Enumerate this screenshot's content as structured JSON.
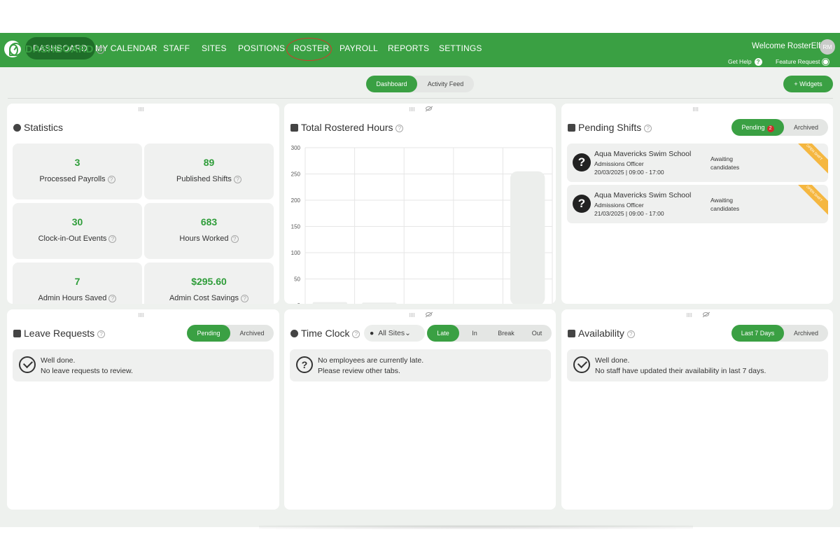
{
  "nav": {
    "items": [
      "DASHBOARD",
      "MY CALENDAR",
      "STAFF",
      "SITES",
      "POSITIONS",
      "ROSTER",
      "PAYROLL",
      "REPORTS",
      "SETTINGS"
    ],
    "welcome": "Welcome RosterElf",
    "avatar_initials": "RM",
    "get_help": "Get Help",
    "help_glyph": "?",
    "feature_request": "Feature Request"
  },
  "page": {
    "title": "DASHBOARD",
    "view_tabs": [
      "Dashboard",
      "Activity Feed"
    ],
    "widgets_button": "+ Widgets",
    "help_glyph": "?"
  },
  "statistics": {
    "title": "Statistics",
    "items": [
      {
        "value": "3",
        "label": "Processed Payrolls"
      },
      {
        "value": "89",
        "label": "Published Shifts"
      },
      {
        "value": "30",
        "label": "Clock-in-Out Events"
      },
      {
        "value": "683",
        "label": "Hours Worked"
      },
      {
        "value": "7",
        "label": "Admin Hours Saved"
      },
      {
        "value": "$295.60",
        "label": "Admin Cost Savings"
      }
    ]
  },
  "rostered_hours": {
    "title": "Total Rostered Hours"
  },
  "chart_data": {
    "type": "bar",
    "title": "Total Rostered Hours",
    "ylim": [
      0,
      300
    ],
    "yticks": [
      0,
      50,
      100,
      150,
      200,
      250,
      300
    ],
    "values": [
      6,
      5,
      2,
      0,
      255
    ],
    "bar_color": "#eceeec"
  },
  "pending_shifts": {
    "title": "Pending Shifts",
    "tabs": [
      "Pending",
      "Archived"
    ],
    "badge": "2",
    "shifts": [
      {
        "school": "Aqua Mavericks Swim School",
        "position": "Admissions Officer",
        "datetime": "20/03/2025 | 09:00 - 17:00",
        "status_line1": "Awaiting",
        "status_line2": "candidates",
        "ribbon": "OPEN SHIFT"
      },
      {
        "school": "Aqua Mavericks Swim School",
        "position": "Admissions Officer",
        "datetime": "21/03/2025 | 09:00 - 17:00",
        "status_line1": "Awaiting",
        "status_line2": "candidates",
        "ribbon": "OPEN SHIFT"
      }
    ]
  },
  "leave_requests": {
    "title": "Leave Requests",
    "tabs": [
      "Pending",
      "Archived"
    ],
    "msg_line1": "Well done.",
    "msg_line2": "No leave requests to review."
  },
  "time_clock": {
    "title": "Time Clock",
    "site_select": "All Sites",
    "tabs": [
      "Late",
      "In",
      "Break",
      "Out"
    ],
    "msg_line1": "No employees are currently late.",
    "msg_line2": "Please review other tabs."
  },
  "availability": {
    "title": "Availability",
    "tabs": [
      "Last 7 Days",
      "Archived"
    ],
    "msg_line1": "Well done.",
    "msg_line2": "No staff have updated their availability in last 7 days."
  },
  "colors": {
    "brand_green": "#3aa043",
    "nav_active": "#1f6e29",
    "badge_red": "#d12a2a",
    "ribbon_orange": "#f5b740"
  }
}
